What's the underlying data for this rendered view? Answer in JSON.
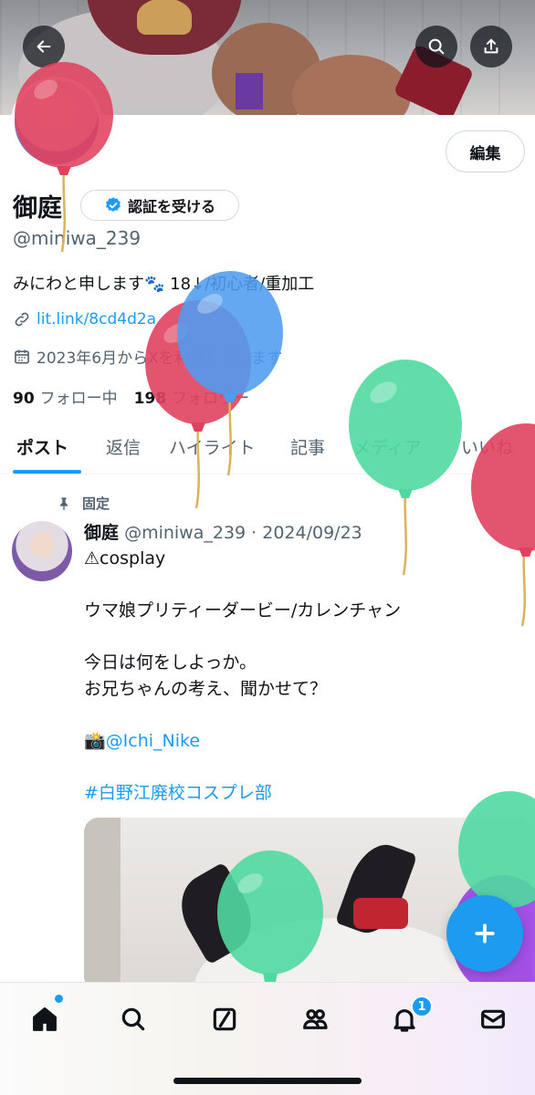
{
  "header": {
    "back_icon": "arrow-left-icon",
    "search_icon": "search-icon",
    "share_icon": "share-icon"
  },
  "profile": {
    "edit_label": "編集",
    "name": "御庭",
    "verify_label": "認証を受ける",
    "handle": "@miniwa_239",
    "bio": "みにわと申します🐾 18↓/初心者/重加工",
    "link": "lit.link/8cd4d2a",
    "joined": "2023年6月からXを利用しています",
    "following_count": "90",
    "following_label": "フォロー中",
    "followers_count": "198",
    "followers_label": "フォロワー"
  },
  "tabs": [
    "ポスト",
    "返信",
    "ハイライト",
    "記事",
    "メディア",
    "いいね"
  ],
  "post": {
    "pinned_label": "固定",
    "author_name": "御庭",
    "author_meta": "@miniwa_239 · 2024/09/23",
    "line1": "⚠cosplay",
    "line2": "ウマ娘プリティーダービー/カレンチャン",
    "line3a": "今日は何をしよっか。",
    "line3b": "お兄ちゃんの考え、聞かせて？",
    "camera_emoji": "📸",
    "photographer": "@Ichi_Nike",
    "hashtag": "#白野江廃校コスプレ部"
  },
  "fab_icon": "plus-icon",
  "nav": {
    "items": [
      "home-icon",
      "search-icon",
      "grok-icon",
      "communities-icon",
      "notifications-icon",
      "messages-icon"
    ],
    "notification_count": "1"
  },
  "colors": {
    "accent": "#1d9bf0",
    "text": "#0f1419",
    "muted": "#536471",
    "balloon_red": "#e0415e",
    "balloon_blue": "#4e9cf0",
    "balloon_green": "#4fd9a0",
    "balloon_purple": "#9b40e6"
  }
}
